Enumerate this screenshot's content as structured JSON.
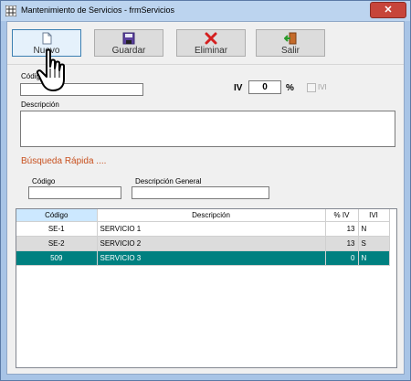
{
  "window": {
    "title": "Mantenimiento de Servicios - frmServicios",
    "close_glyph": "✕"
  },
  "toolbar": {
    "nuevo": "Nuevo",
    "guardar": "Guardar",
    "eliminar": "Eliminar",
    "salir": "Salir"
  },
  "form": {
    "codigo_label": "Código",
    "codigo_value": "",
    "iv_label": "IV",
    "iv_value": "0",
    "percent": "%",
    "ivi_label": "IVI",
    "descripcion_label": "Descripción",
    "descripcion_value": ""
  },
  "search": {
    "title": "Búsqueda Rápida ....",
    "codigo_label": "Código",
    "codigo_value": "",
    "desc_label": "Descripción General",
    "desc_value": ""
  },
  "table": {
    "columns": [
      "Código",
      "Descripción",
      "% IV",
      "IVI"
    ],
    "rows": [
      {
        "codigo": "SE-1",
        "descripcion": "SERVICIO 1",
        "iv": "13",
        "ivi": "N"
      },
      {
        "codigo": "SE-2",
        "descripcion": "SERVICIO 2",
        "iv": "13",
        "ivi": "S"
      },
      {
        "codigo": "509",
        "descripcion": "SERVICIO 3",
        "iv": "0",
        "ivi": "N"
      }
    ]
  },
  "colors": {
    "selected_row": "#008080",
    "accent_orange": "#c8501e"
  }
}
